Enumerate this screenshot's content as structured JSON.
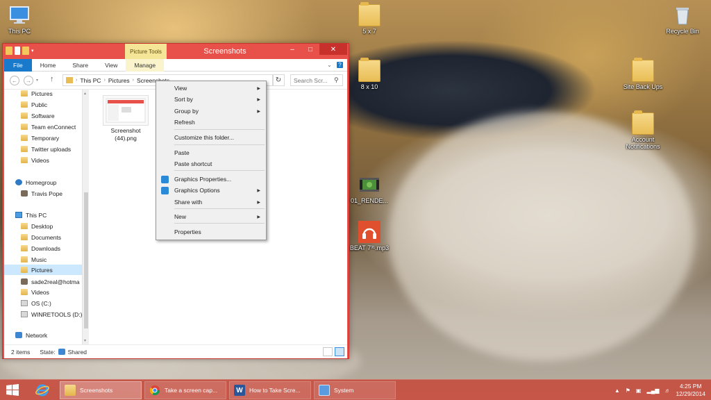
{
  "desktop": {
    "icons": [
      {
        "label": "This PC",
        "icon": "computer-icon"
      },
      {
        "label": "5 x 7",
        "icon": "folder-icon"
      },
      {
        "label": "8 x 10",
        "icon": "folder-icon"
      },
      {
        "label": "Recycle Bin",
        "icon": "recycle-bin-icon"
      },
      {
        "label": "Site Back Ups",
        "icon": "folder-icon"
      },
      {
        "label": "Account Notifications",
        "icon": "folder-icon"
      },
      {
        "label": "01_RENDE...",
        "icon": "video-icon"
      },
      {
        "label": "BEAT 7³¹.mp3",
        "icon": "audio-icon"
      }
    ]
  },
  "explorer": {
    "title": "Screenshots",
    "contextual_tab_group": "Picture Tools",
    "ribbon_tabs": [
      "File",
      "Home",
      "Share",
      "View",
      "Manage"
    ],
    "breadcrumb": [
      "This PC",
      "Pictures",
      "Screenshots"
    ],
    "search_placeholder": "Search Scr...",
    "nav_items": [
      {
        "label": "Pictures",
        "icon": "folder"
      },
      {
        "label": "Public",
        "icon": "folder"
      },
      {
        "label": "Software",
        "icon": "folder"
      },
      {
        "label": "Team enConnect",
        "icon": "folder"
      },
      {
        "label": "Temporary",
        "icon": "folder"
      },
      {
        "label": "Twitter uploads",
        "icon": "folder"
      },
      {
        "label": "Videos",
        "icon": "folder"
      },
      {
        "label": "Homegroup",
        "icon": "group"
      },
      {
        "label": "Travis Pope",
        "icon": "person"
      },
      {
        "label": "This PC",
        "icon": "pc"
      },
      {
        "label": "Desktop",
        "icon": "folder"
      },
      {
        "label": "Documents",
        "icon": "folder"
      },
      {
        "label": "Downloads",
        "icon": "folder"
      },
      {
        "label": "Music",
        "icon": "folder"
      },
      {
        "label": "Pictures",
        "icon": "folder"
      },
      {
        "label": "sade2real@hotma",
        "icon": "person"
      },
      {
        "label": "Videos",
        "icon": "folder"
      },
      {
        "label": "OS (C:)",
        "icon": "drive"
      },
      {
        "label": "WINRETOOLS (D:)",
        "icon": "drive"
      },
      {
        "label": "Network",
        "icon": "net"
      }
    ],
    "selected_nav": "Pictures",
    "file": {
      "name_line1": "Screenshot",
      "name_line2": "(44).png"
    },
    "status": {
      "items": "2 items",
      "state_label": "State:",
      "state_value": "Shared"
    }
  },
  "context_menu": {
    "items": [
      {
        "label": "View",
        "submenu": true
      },
      {
        "label": "Sort by",
        "submenu": true
      },
      {
        "label": "Group by",
        "submenu": true
      },
      {
        "label": "Refresh",
        "submenu": false
      },
      {
        "label": "Customize this folder...",
        "submenu": false
      },
      {
        "label": "Paste",
        "submenu": false
      },
      {
        "label": "Paste shortcut",
        "submenu": false
      },
      {
        "label": "Graphics Properties...",
        "submenu": false,
        "icon": "graphics-icon"
      },
      {
        "label": "Graphics Options",
        "submenu": true,
        "icon": "graphics-icon"
      },
      {
        "label": "Share with",
        "submenu": true
      },
      {
        "label": "New",
        "submenu": true
      },
      {
        "label": "Properties",
        "submenu": false
      }
    ]
  },
  "taskbar": {
    "tasks": [
      {
        "label": "Screenshots",
        "icon": "folder-icon",
        "active": true
      },
      {
        "label": "Take a screen cap...",
        "icon": "chrome-icon",
        "active": false
      },
      {
        "label": "How to Take Scre...",
        "icon": "word-icon",
        "active": false
      },
      {
        "label": "System",
        "icon": "system-icon",
        "active": false
      }
    ],
    "clock_time": "4:25 PM",
    "clock_date": "12/29/2014"
  },
  "colors": {
    "window_frame": "#e8504a",
    "file_tab": "#1979ca",
    "picture_tools": "#f5e597",
    "taskbar": "#c64e40"
  }
}
